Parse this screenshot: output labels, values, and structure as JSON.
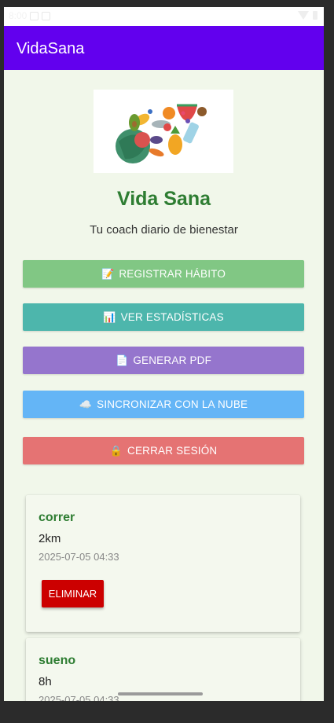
{
  "status_bar": {
    "time": "8:00"
  },
  "app_bar": {
    "title": "VidaSana"
  },
  "header": {
    "title": "Vida Sana",
    "subtitle": "Tu coach diario de bienestar"
  },
  "actions": [
    {
      "icon": "📝",
      "label": "REGISTRAR HÁBITO",
      "color": "#81c784"
    },
    {
      "icon": "📊",
      "label": "VER ESTADÍSTICAS",
      "color": "#4db6ac"
    },
    {
      "icon": "📄",
      "label": "GENERAR PDF",
      "color": "#9575cd"
    },
    {
      "icon": "☁️",
      "label": "SINCRONIZAR CON LA NUBE",
      "color": "#64b5f6"
    },
    {
      "icon": "🔒",
      "label": "CERRAR SESIÓN",
      "color": "#e57373"
    }
  ],
  "habits": [
    {
      "name": "correr",
      "value": "2km",
      "date": "2025-07-05 04:33",
      "delete_label": "ELIMINAR"
    },
    {
      "name": "sueno",
      "value": "8h",
      "date": "2025-07-05 04:33"
    }
  ],
  "colors": {
    "app_bar": "#6200ee",
    "background": "#f1f7ea",
    "title_green": "#2e7d32",
    "delete_red": "#cc0000"
  }
}
